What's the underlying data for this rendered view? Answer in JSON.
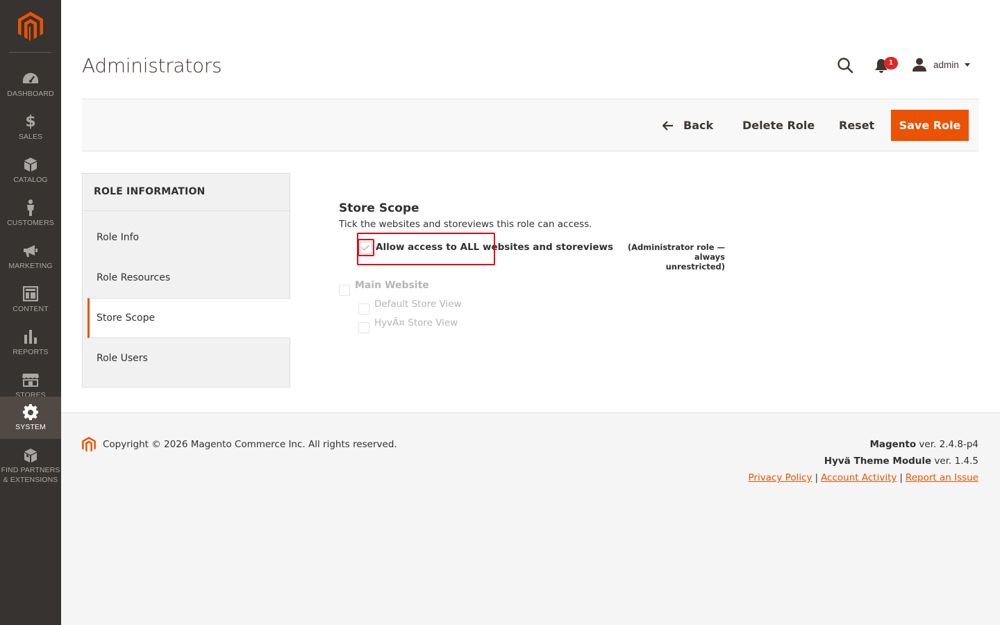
{
  "sidebar": {
    "items": [
      {
        "label": "DASHBOARD",
        "icon": "dashboard-icon"
      },
      {
        "label": "SALES",
        "icon": "dollar-icon"
      },
      {
        "label": "CATALOG",
        "icon": "box-icon"
      },
      {
        "label": "CUSTOMERS",
        "icon": "person-icon"
      },
      {
        "label": "MARKETING",
        "icon": "megaphone-icon"
      },
      {
        "label": "CONTENT",
        "icon": "layout-icon"
      },
      {
        "label": "REPORTS",
        "icon": "bar-chart-icon"
      },
      {
        "label": "STORES",
        "icon": "storefront-icon"
      },
      {
        "label": "SYSTEM",
        "icon": "gear-icon",
        "active": true
      },
      {
        "label": "FIND PARTNERS\n& EXTENSIONS",
        "label1": "FIND PARTNERS",
        "label2": "& EXTENSIONS",
        "icon": "boxes-icon"
      }
    ]
  },
  "header": {
    "title": "Administrators",
    "notification_count": "1",
    "username": "admin"
  },
  "actions": {
    "back": "Back",
    "delete": "Delete Role",
    "reset": "Reset",
    "save": "Save Role"
  },
  "tabs": {
    "title": "ROLE INFORMATION",
    "items": [
      "Role Info",
      "Role Resources",
      "Store Scope",
      "Role Users"
    ],
    "active": "Store Scope"
  },
  "scope": {
    "title": "Store Scope",
    "description": "Tick the websites and storeviews this role can access.",
    "all_label": "Allow access to ALL websites and storeviews",
    "all_checked": true,
    "admin_note_line1": "(Administrator role — always",
    "admin_note_line2": "unrestricted)",
    "website": "Main Website",
    "store_views": [
      "Default Store View",
      "HyvÃ¤ Store View"
    ]
  },
  "footer": {
    "copyright": "Copyright © 2026 Magento Commerce Inc. All rights reserved.",
    "magento_name": "Magento",
    "magento_version": " ver. 2.4.8-p4",
    "hyva_name": "Hyvä Theme Module",
    "hyva_version": " ver. 1.4.5",
    "links": [
      "Privacy Policy",
      "Account Activity",
      "Report an Issue"
    ]
  },
  "colors": {
    "sidebar_bg": "#373330",
    "accent": "#eb5202",
    "highlight": "#e30613",
    "badge": "#e22626"
  }
}
